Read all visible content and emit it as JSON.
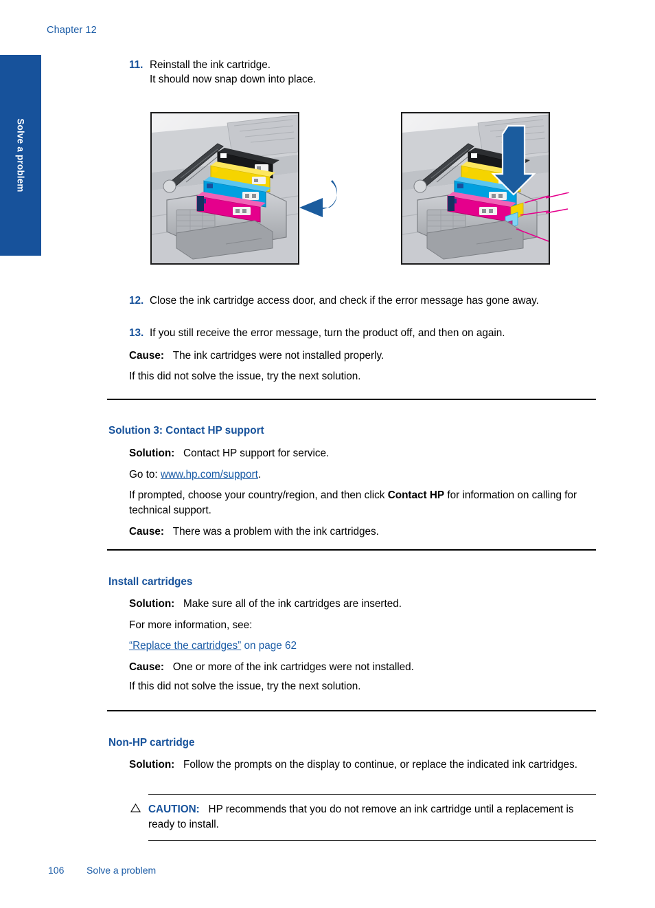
{
  "page": {
    "chapter_label": "Chapter 12",
    "side_tab_label": "Solve a problem",
    "footer_page_number": "106",
    "footer_section": "Solve a problem",
    "accent_blue": "#17529b",
    "link_blue": "#1a5ba6",
    "tab_blue": "#17529b"
  },
  "steps": [
    {
      "number": "11.",
      "line1": "Reinstall the ink cartridge.",
      "line2": "It should now snap down into place."
    },
    {
      "number": "12.",
      "text": "Close the ink cartridge access door, and check if the error message has gone away."
    },
    {
      "number": "13.",
      "text": "If you still receive the error message, turn the product off, and then on again."
    }
  ],
  "figures": {
    "left": {
      "alt_name": "printer-carriage-push-cartridge",
      "arrow_color": "#1b5c9e",
      "arrow_direction": "curved-left"
    },
    "right": {
      "alt_name": "printer-carriage-press-down-cartridge",
      "arrow_color": "#1b5c9e",
      "arrow_direction": "down",
      "callout_color": "#e5008c"
    },
    "cartridge_colors": {
      "black": "#1a1a1a",
      "yellow": "#f5d400",
      "cyan": "#00a0e0",
      "magenta": "#e5008c",
      "body_gray": "#b9bcc0"
    }
  },
  "section_step_group": {
    "cause_label": "Cause:",
    "cause_text": "The ink cartridges were not installed properly.",
    "next_solution": "If this did not solve the issue, try the next solution."
  },
  "solution3": {
    "heading": "Solution 3: Contact HP support",
    "solution_label": "Solution:",
    "solution_text": "Contact HP support for service.",
    "goto_prefix": "Go to: ",
    "goto_link": "www.hp.com/support",
    "goto_suffix": ".",
    "prompt_part1": "If prompted, choose your country/region, and then click ",
    "prompt_bold": "Contact HP",
    "prompt_part2": " for information on calling for technical support.",
    "cause_label": "Cause:",
    "cause_text": "There was a problem with the ink cartridges."
  },
  "install_cartridges": {
    "heading": "Install cartridges",
    "solution_label": "Solution:",
    "solution_text": "Make sure all of the ink cartridges are inserted.",
    "more_info": "For more information, see:",
    "xref_quoted": "“Replace the cartridges”",
    "xref_tail": " on page 62",
    "cause_label": "Cause:",
    "cause_text": "One or more of the ink cartridges were not installed.",
    "next_solution": "If this did not solve the issue, try the next solution."
  },
  "non_hp": {
    "heading": "Non-HP cartridge",
    "solution_label": "Solution:",
    "solution_text": "Follow the prompts on the display to continue, or replace the indicated ink cartridges.",
    "caution_label": "CAUTION:",
    "caution_text": "HP recommends that you do not remove an ink cartridge until a replacement is ready to install.",
    "caution_icon": "warning-triangle-icon"
  }
}
